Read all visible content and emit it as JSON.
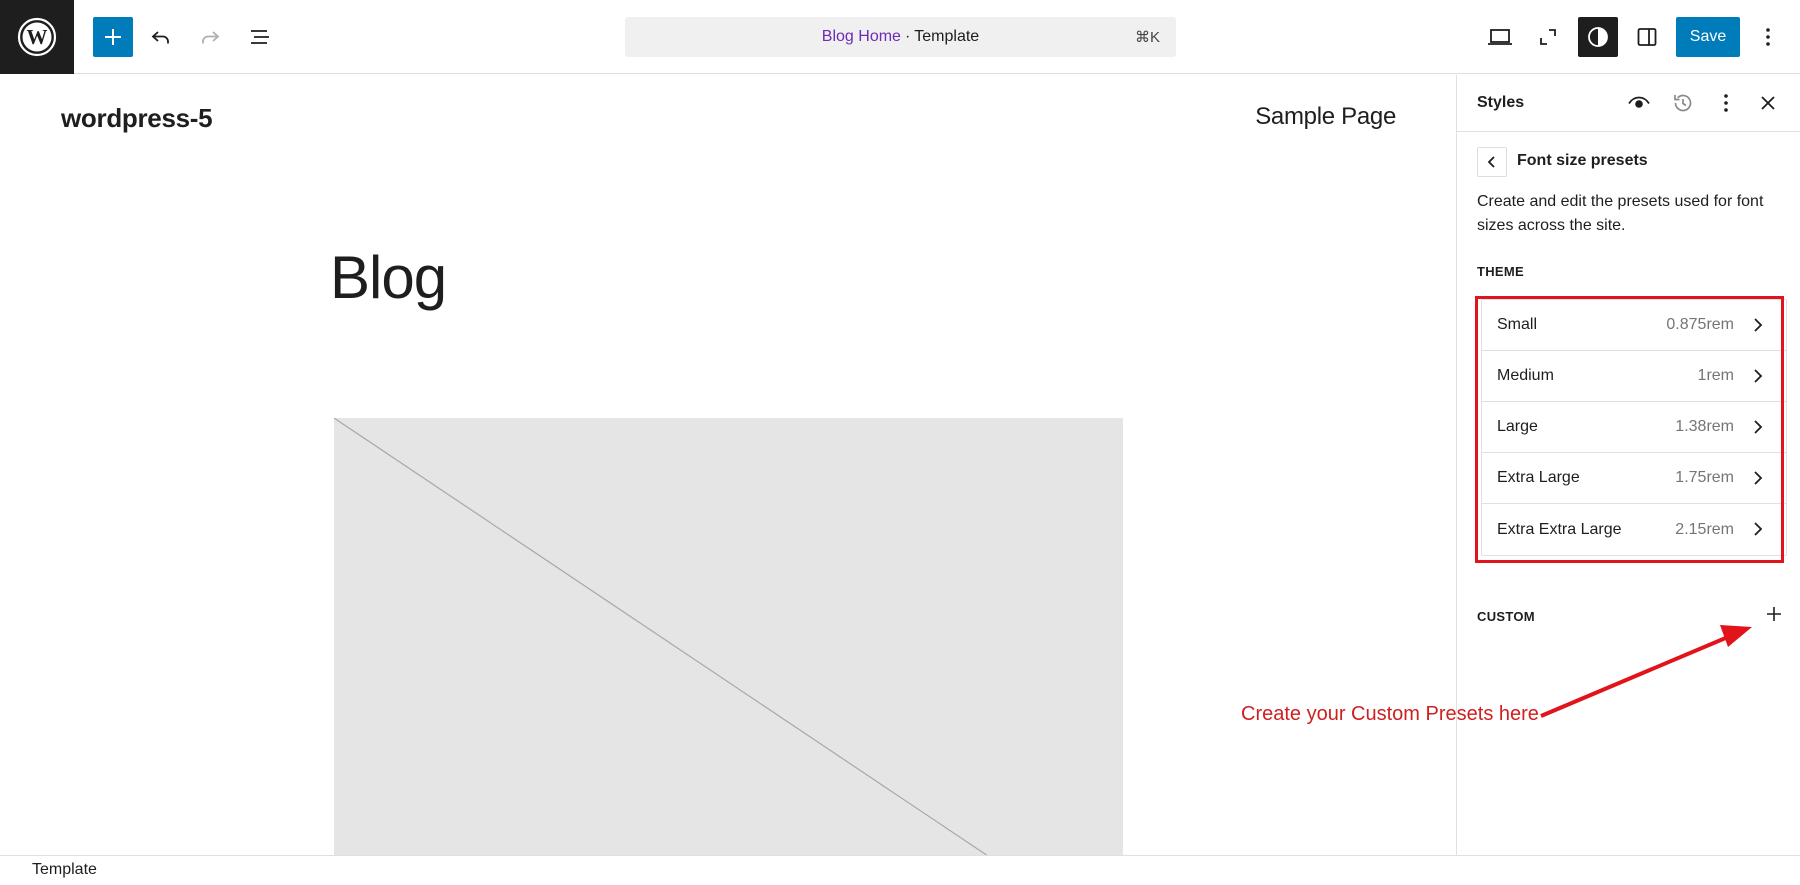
{
  "topbar": {
    "logo_icon": "wordpress-logo-icon",
    "add_icon": "plus-icon",
    "undo_icon": "undo-icon",
    "redo_icon": "redo-icon",
    "listview_icon": "list-view-icon",
    "command": {
      "title": "Blog Home",
      "separator": "·",
      "type": "Template",
      "shortcut": "⌘K"
    },
    "save_label": "Save"
  },
  "canvas": {
    "site_title": "wordpress-5",
    "nav_item": "Sample Page",
    "heading": "Blog"
  },
  "sidebar": {
    "title": "Styles",
    "panel_title": "Font size presets",
    "description": "Create and edit the presets used for font sizes across the site.",
    "theme_label": "THEME",
    "presets": [
      {
        "name": "Small",
        "value": "0.875rem"
      },
      {
        "name": "Medium",
        "value": "1rem"
      },
      {
        "name": "Large",
        "value": "1.38rem"
      },
      {
        "name": "Extra Large",
        "value": "1.75rem"
      },
      {
        "name": "Extra Extra Large",
        "value": "2.15rem"
      }
    ],
    "custom_label": "CUSTOM"
  },
  "annotation": {
    "text": "Create your Custom Presets here",
    "color": "#cf1f1f"
  },
  "footer": {
    "label": "Template"
  },
  "colors": {
    "accent": "#007cba",
    "link": "#6e2bb3",
    "highlight": "#e1131b"
  }
}
